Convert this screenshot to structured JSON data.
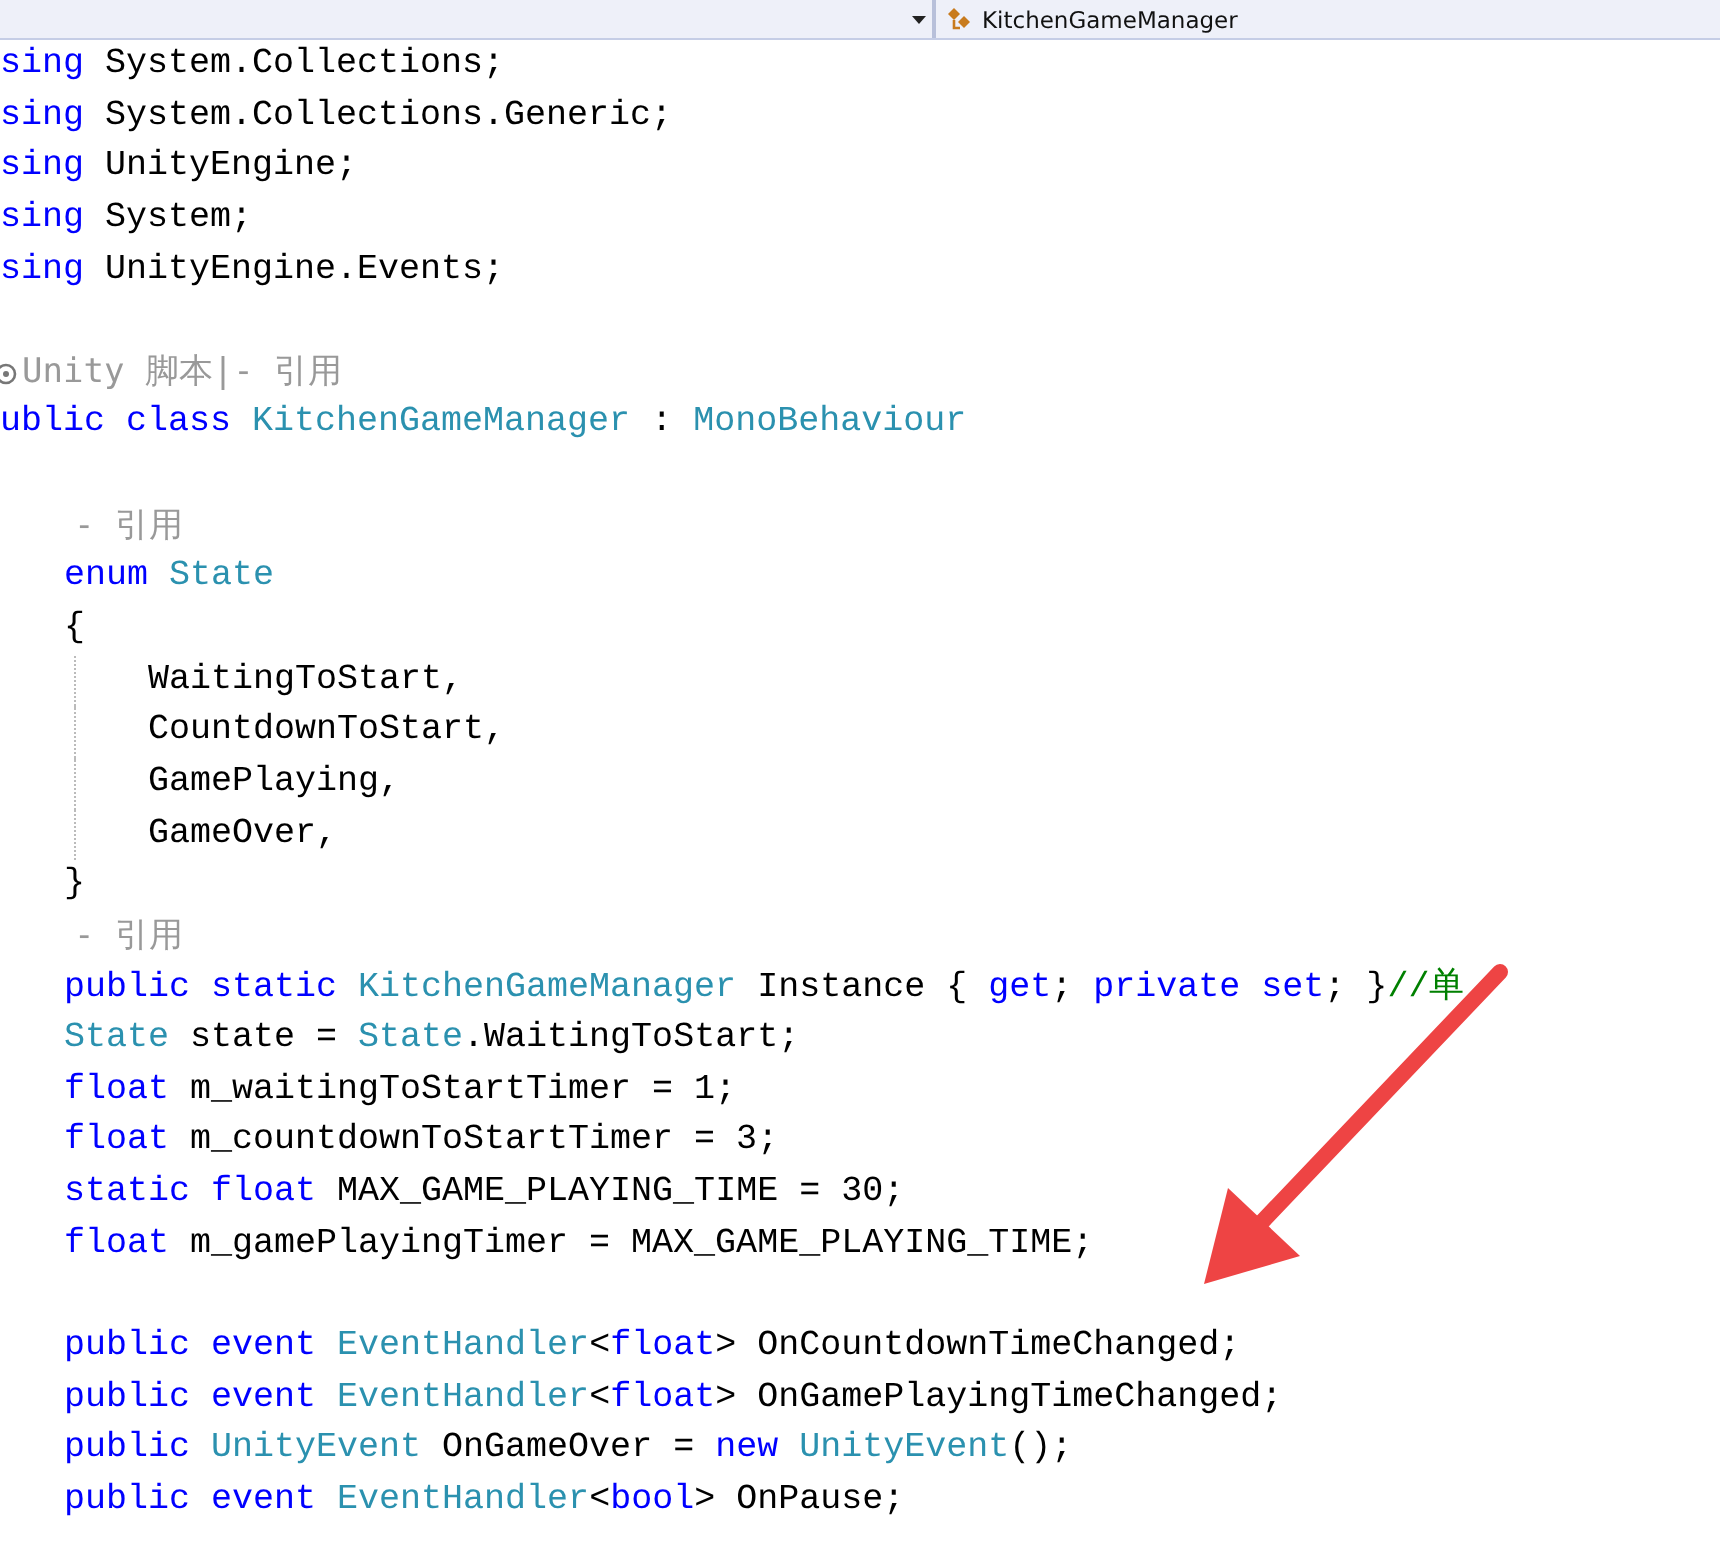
{
  "navigation_bar": {
    "member_dropdown": {
      "value": "KitchenGameManager"
    }
  },
  "editor": {
    "lines": [
      {
        "kind": "top-code",
        "tokens": [
          {
            "kind": "keyword",
            "text": "sing"
          },
          {
            "kind": "plain",
            "text": " System.Collections;"
          }
        ]
      },
      {
        "kind": "top-code",
        "tokens": [
          {
            "kind": "keyword",
            "text": "sing"
          },
          {
            "kind": "plain",
            "text": " System.Collections.Generic;"
          }
        ]
      },
      {
        "kind": "top-code",
        "tokens": [
          {
            "kind": "keyword",
            "text": "sing"
          },
          {
            "kind": "plain",
            "text": " UnityEngine;"
          }
        ]
      },
      {
        "kind": "top-code",
        "tokens": [
          {
            "kind": "keyword",
            "text": "sing"
          },
          {
            "kind": "plain",
            "text": " System;"
          }
        ]
      },
      {
        "kind": "top-code",
        "tokens": [
          {
            "kind": "keyword",
            "text": "sing"
          },
          {
            "kind": "plain",
            "text": " UnityEngine.Events;"
          }
        ]
      },
      {
        "kind": "blank"
      },
      {
        "kind": "unity-lens",
        "text": "Unity 脚本|- 引用"
      },
      {
        "kind": "top-code",
        "tokens": [
          {
            "kind": "keyword",
            "text": "ublic class"
          },
          {
            "kind": "type",
            "text": " KitchenGameManager"
          },
          {
            "kind": "plain",
            "text": " : "
          },
          {
            "kind": "type",
            "text": "MonoBehaviour"
          }
        ]
      },
      {
        "kind": "blank"
      },
      {
        "kind": "member-lens",
        "text": "- 引用"
      },
      {
        "kind": "member-code",
        "tokens": [
          {
            "kind": "keyword",
            "text": "enum"
          },
          {
            "kind": "type",
            "text": " State"
          }
        ]
      },
      {
        "kind": "member-code",
        "tokens": [
          {
            "kind": "brace",
            "text": "{"
          }
        ]
      },
      {
        "kind": "nested-code",
        "tokens": [
          {
            "kind": "plain",
            "text": "WaitingToStart,"
          }
        ]
      },
      {
        "kind": "nested-code",
        "tokens": [
          {
            "kind": "plain",
            "text": "CountdownToStart,"
          }
        ]
      },
      {
        "kind": "nested-code",
        "tokens": [
          {
            "kind": "plain",
            "text": "GamePlaying,"
          }
        ]
      },
      {
        "kind": "nested-code",
        "tokens": [
          {
            "kind": "plain",
            "text": "GameOver,"
          }
        ]
      },
      {
        "kind": "member-code",
        "tokens": [
          {
            "kind": "brace",
            "text": "}"
          }
        ]
      },
      {
        "kind": "member-lens",
        "text": "- 引用"
      },
      {
        "kind": "member-code",
        "tokens": [
          {
            "kind": "keyword",
            "text": "public static"
          },
          {
            "kind": "type",
            "text": " KitchenGameManager"
          },
          {
            "kind": "plain",
            "text": " Instance { "
          },
          {
            "kind": "keyword",
            "text": "get"
          },
          {
            "kind": "plain",
            "text": "; "
          },
          {
            "kind": "keyword",
            "text": "private set"
          },
          {
            "kind": "plain",
            "text": "; }"
          },
          {
            "kind": "comment",
            "text": "//单"
          }
        ]
      },
      {
        "kind": "member-code",
        "tokens": [
          {
            "kind": "type",
            "text": "State"
          },
          {
            "kind": "plain",
            "text": " state = "
          },
          {
            "kind": "type",
            "text": "State"
          },
          {
            "kind": "plain",
            "text": ".WaitingToStart;"
          }
        ]
      },
      {
        "kind": "member-code",
        "tokens": [
          {
            "kind": "keyword",
            "text": "float"
          },
          {
            "kind": "plain",
            "text": " m_waitingToStartTimer = 1;"
          }
        ]
      },
      {
        "kind": "member-code",
        "tokens": [
          {
            "kind": "keyword",
            "text": "float"
          },
          {
            "kind": "plain",
            "text": " m_countdownToStartTimer = 3;"
          }
        ]
      },
      {
        "kind": "member-code",
        "tokens": [
          {
            "kind": "keyword",
            "text": "static float"
          },
          {
            "kind": "plain",
            "text": " MAX_GAME_PLAYING_TIME = 30;"
          }
        ]
      },
      {
        "kind": "member-code",
        "tokens": [
          {
            "kind": "keyword",
            "text": "float"
          },
          {
            "kind": "plain",
            "text": " m_gamePlayingTimer = MAX_GAME_PLAYING_TIME;"
          }
        ]
      },
      {
        "kind": "blank"
      },
      {
        "kind": "member-code",
        "tokens": [
          {
            "kind": "keyword",
            "text": "public event"
          },
          {
            "kind": "type",
            "text": " EventHandler"
          },
          {
            "kind": "plain",
            "text": "<"
          },
          {
            "kind": "keyword",
            "text": "float"
          },
          {
            "kind": "plain",
            "text": "> OnCountdownTimeChanged;"
          }
        ]
      },
      {
        "kind": "member-code",
        "tokens": [
          {
            "kind": "keyword",
            "text": "public event"
          },
          {
            "kind": "type",
            "text": " EventHandler"
          },
          {
            "kind": "plain",
            "text": "<"
          },
          {
            "kind": "keyword",
            "text": "float"
          },
          {
            "kind": "plain",
            "text": "> OnGamePlayingTimeChanged;"
          }
        ]
      },
      {
        "kind": "member-code",
        "tokens": [
          {
            "kind": "keyword",
            "text": "public"
          },
          {
            "kind": "type",
            "text": " UnityEvent"
          },
          {
            "kind": "plain",
            "text": " OnGameOver = "
          },
          {
            "kind": "keyword",
            "text": "new"
          },
          {
            "kind": "type",
            "text": " UnityEvent"
          },
          {
            "kind": "plain",
            "text": "();"
          }
        ]
      },
      {
        "kind": "member-code",
        "tokens": [
          {
            "kind": "keyword",
            "text": "public event"
          },
          {
            "kind": "type",
            "text": " EventHandler"
          },
          {
            "kind": "plain",
            "text": "<"
          },
          {
            "kind": "keyword",
            "text": "bool"
          },
          {
            "kind": "plain",
            "text": "> OnPause;"
          }
        ]
      }
    ]
  }
}
